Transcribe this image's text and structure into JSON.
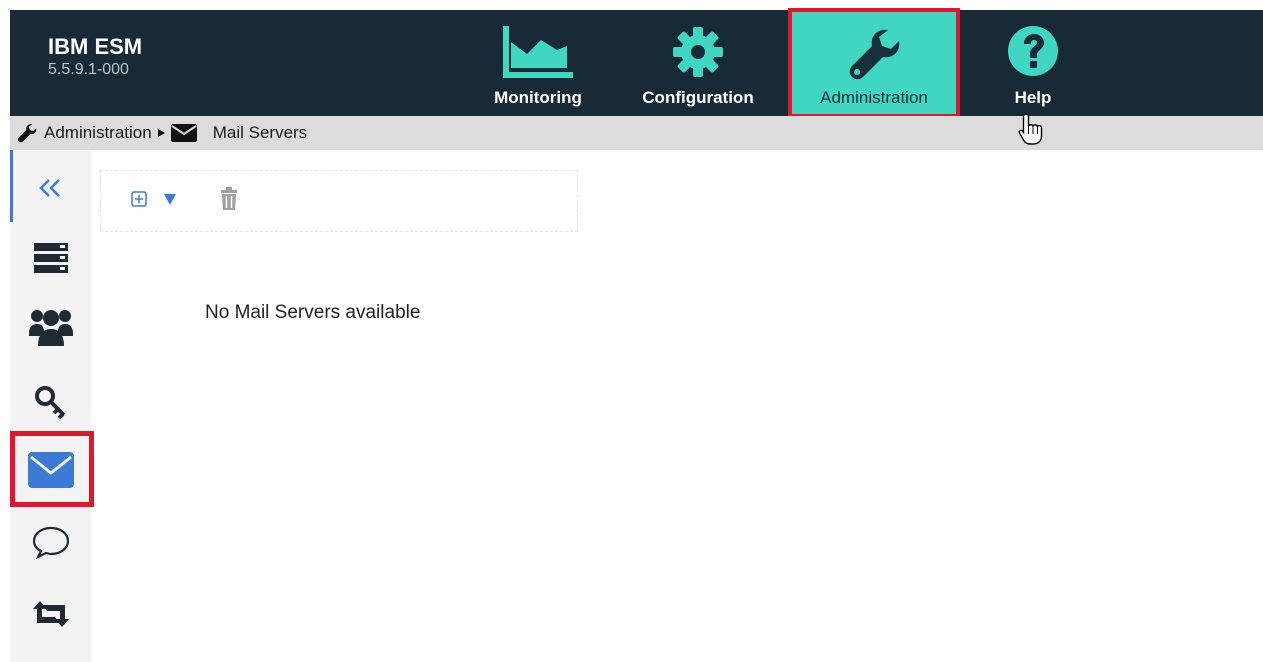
{
  "app": {
    "name": "IBM ESM",
    "version": "5.5.9.1-000"
  },
  "nav": {
    "monitoring": "Monitoring",
    "configuration": "Configuration",
    "administration": "Administration",
    "help": "Help"
  },
  "breadcrumb": {
    "parent": "Administration",
    "current": "Mail Servers"
  },
  "content": {
    "empty_message": "No Mail Servers available"
  },
  "colors": {
    "topbar": "#182a36",
    "accent": "#3fd7c1",
    "highlight": "#e0182d",
    "icon_blue": "#3a7bd5"
  }
}
